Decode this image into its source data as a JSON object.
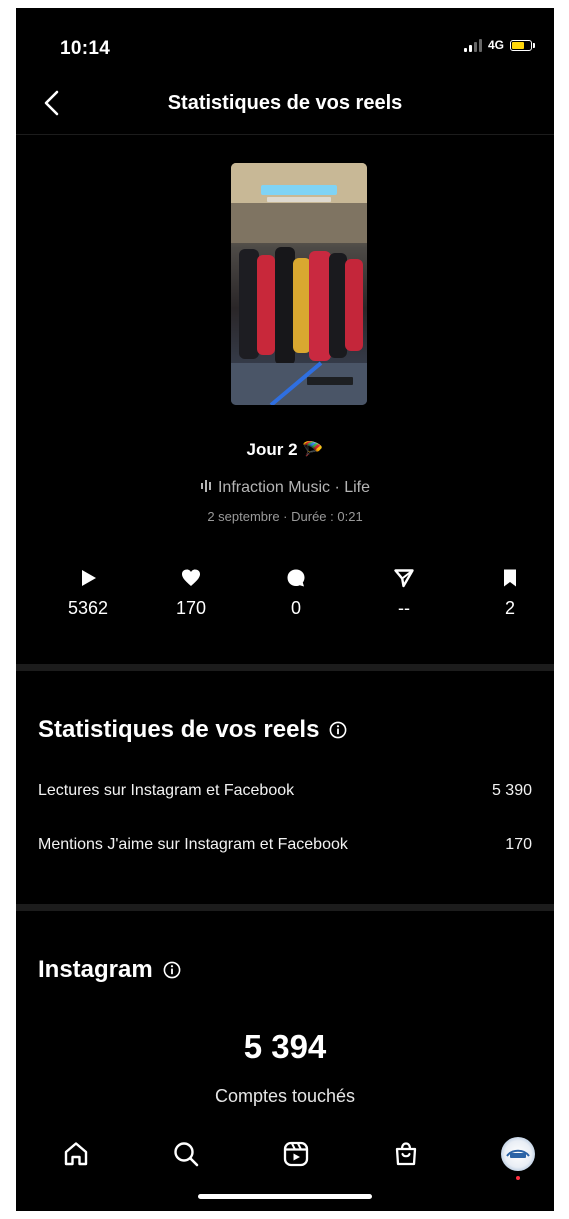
{
  "status_bar": {
    "time": "10:14",
    "network": "4G",
    "battery_level": 0.7,
    "battery_color": "#ffd60a"
  },
  "header": {
    "back_icon": "chevron-left-icon",
    "title": "Statistiques de vos reels"
  },
  "reel": {
    "title": "Jour 2",
    "title_emoji": "🪂",
    "music_icon": "audio-waveform-icon",
    "music": "Infraction Music · Life",
    "meta": "2 septembre · Durée : 0:21"
  },
  "metrics": [
    {
      "icon": "play-icon",
      "value": "5362"
    },
    {
      "icon": "heart-icon",
      "value": "170"
    },
    {
      "icon": "comment-icon",
      "value": "0"
    },
    {
      "icon": "send-icon",
      "value": "--"
    },
    {
      "icon": "bookmark-icon",
      "value": "2"
    }
  ],
  "reel_stats": {
    "title": "Statistiques de vos reels",
    "info_icon": "info-icon",
    "rows": [
      {
        "label": "Lectures sur Instagram et Facebook",
        "value": "5 390"
      },
      {
        "label": "Mentions J'aime sur Instagram et Facebook",
        "value": "170"
      }
    ]
  },
  "instagram": {
    "title": "Instagram",
    "info_icon": "info-icon",
    "accounts_reached": "5 394",
    "accounts_reached_label": "Comptes touchés"
  },
  "tab_bar": {
    "items": [
      {
        "icon": "home-icon"
      },
      {
        "icon": "search-icon"
      },
      {
        "icon": "reels-icon"
      },
      {
        "icon": "shop-icon"
      },
      {
        "icon": "profile-avatar"
      }
    ],
    "notification_dot_color": "#ff3040"
  },
  "colors": {
    "background": "#000000",
    "text": "#ffffff",
    "secondary_text": "#b5b5b5",
    "divider": "#1c1c1c"
  }
}
